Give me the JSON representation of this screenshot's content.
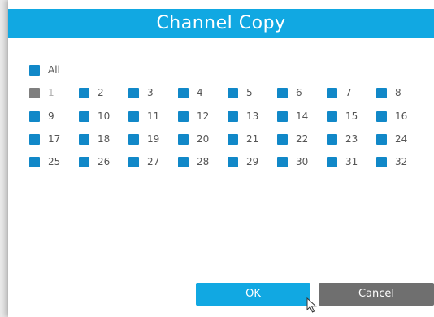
{
  "dialog": {
    "title": "Channel Copy",
    "all_label": "All",
    "channels": [
      "1",
      "2",
      "3",
      "4",
      "5",
      "6",
      "7",
      "8",
      "9",
      "10",
      "11",
      "12",
      "13",
      "14",
      "15",
      "16",
      "17",
      "18",
      "19",
      "20",
      "21",
      "22",
      "23",
      "24",
      "25",
      "26",
      "27",
      "28",
      "29",
      "30",
      "31",
      "32"
    ],
    "disabled_channel": "1",
    "ok_label": "OK",
    "cancel_label": "Cancel"
  },
  "colors": {
    "accent": "#11a8e2",
    "checkbox": "#1188c8",
    "checkbox_disabled": "#7f7f7f",
    "cancel": "#6f6f6f"
  }
}
